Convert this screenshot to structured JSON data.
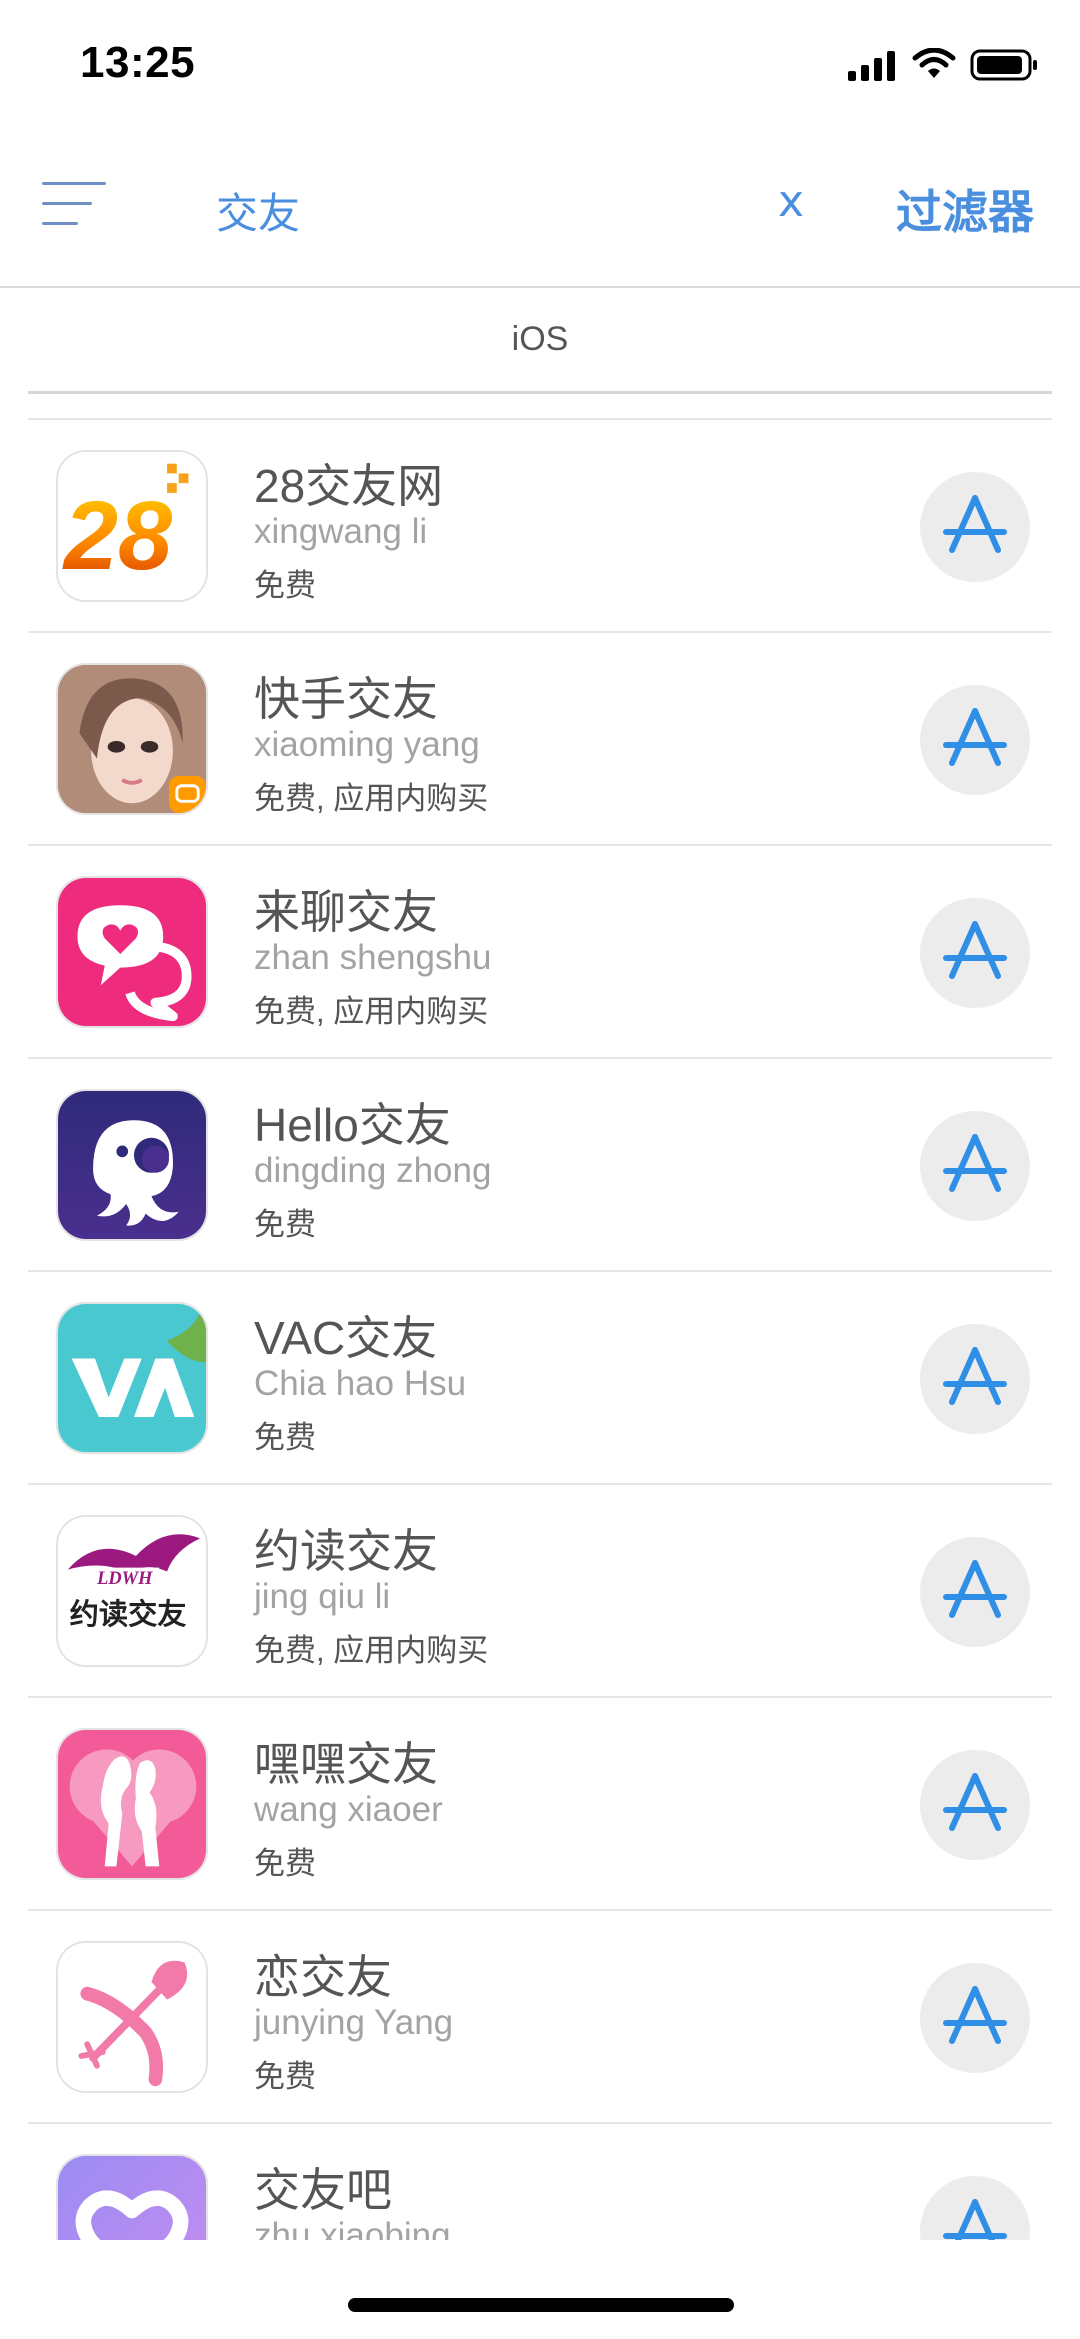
{
  "status_bar": {
    "time": "13:25",
    "icons": [
      "cellular-signal-icon",
      "wifi-icon",
      "battery-icon"
    ]
  },
  "nav": {
    "menu_icon": "hamburger-menu-icon",
    "search_query": "交友",
    "clear_label": "x",
    "filter_label": "过滤器"
  },
  "platform": {
    "label": "iOS"
  },
  "colors": {
    "accent": "#4a8ee0",
    "store_icon": "#2f8ee6",
    "store_button_bg": "#ececec"
  },
  "apps": [
    {
      "name": "28交友网",
      "developer": "xingwang li",
      "price": "免费",
      "icon": "28-logo-icon",
      "store_icon": "app-store-icon"
    },
    {
      "name": "快手交友",
      "developer": "xiaoming yang",
      "price": "免费, 应用内购买",
      "icon": "portrait-photo-icon",
      "store_icon": "app-store-icon"
    },
    {
      "name": "来聊交友",
      "developer": "zhan shengshu",
      "price": "免费, 应用内购买",
      "icon": "heart-chat-bubble-icon",
      "store_icon": "app-store-icon"
    },
    {
      "name": "Hello交友",
      "developer": "dingding zhong",
      "price": "免费",
      "icon": "octopus-icon",
      "store_icon": "app-store-icon"
    },
    {
      "name": "VAC交友",
      "developer": "Chia hao Hsu",
      "price": "免费",
      "icon": "va-letters-icon",
      "store_icon": "app-store-icon"
    },
    {
      "name": "约读交友",
      "developer": "jing qiu li",
      "price": "免费, 应用内购买",
      "icon": "ldwh-logo-icon",
      "icon_text": "约读交友",
      "icon_sub": "LDWH",
      "store_icon": "app-store-icon"
    },
    {
      "name": "嘿嘿交友",
      "developer": "wang xiaoer",
      "price": "免费",
      "icon": "kissing-couple-icon",
      "store_icon": "app-store-icon"
    },
    {
      "name": "恋交友",
      "developer": "junying Yang",
      "price": "免费",
      "icon": "cupid-bow-icon",
      "store_icon": "app-store-icon"
    },
    {
      "name": "交友吧",
      "developer": "zhu xiaobing",
      "price": "",
      "icon": "heart-outline-icon",
      "store_icon": "app-store-icon"
    }
  ],
  "home_indicator": "home-indicator"
}
